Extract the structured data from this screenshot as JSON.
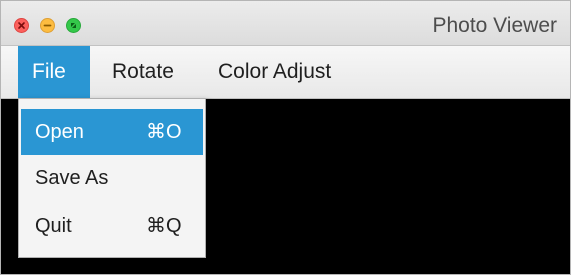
{
  "window": {
    "title": "Photo Viewer"
  },
  "traffic_lights": {
    "close_icon": "close-icon",
    "minimize_icon": "minimize-icon",
    "maximize_icon": "maximize-icon",
    "colors": {
      "close": "#fc605c",
      "minimize": "#fdbc40",
      "maximize": "#34c84a"
    }
  },
  "menubar": {
    "items": [
      {
        "label": "File",
        "active": true
      },
      {
        "label": "Rotate",
        "active": false
      },
      {
        "label": "Color Adjust",
        "active": false
      }
    ]
  },
  "file_menu": {
    "items": [
      {
        "label": "Open",
        "shortcut": "⌘O",
        "highlighted": true
      },
      {
        "label": "Save As",
        "shortcut": "",
        "highlighted": false
      },
      {
        "label": "Quit",
        "shortcut": "⌘Q",
        "highlighted": false
      }
    ]
  },
  "colors": {
    "accent": "#2a96d3",
    "canvas": "#000000"
  }
}
